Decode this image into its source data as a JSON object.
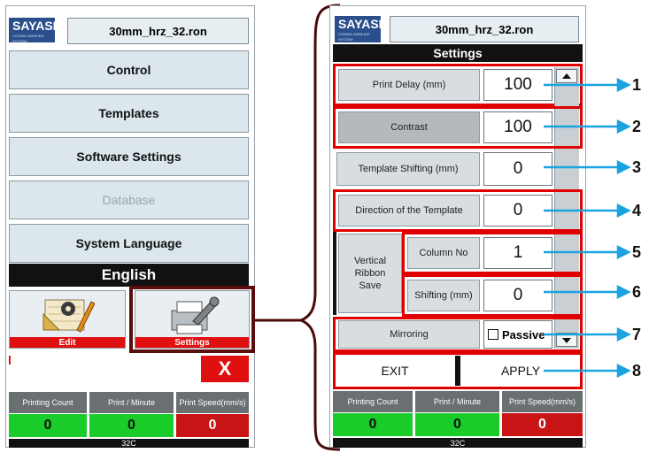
{
  "left": {
    "logo": "SAYASIS",
    "logo_sub": "CODING MARKING SYSTEM",
    "filename": "30mm_hrz_32.ron",
    "menu": [
      "Control",
      "Templates",
      "Software Settings",
      "Database",
      "System Language"
    ],
    "language": "English",
    "edit_label": "Edit",
    "settings_label": "Settings",
    "close_label": "X",
    "stats": {
      "printing_count_label": "Printing Count",
      "print_minute_label": "Print / Minute",
      "print_speed_label": "Print Speed(mm/s)",
      "printing_count": "0",
      "print_minute": "0",
      "print_speed": "0"
    },
    "footer": "32C"
  },
  "right": {
    "logo": "SAYASIS",
    "logo_sub": "CODING MARKING SYSTEM",
    "filename": "30mm_hrz_32.ron",
    "header": "Settings",
    "rows": {
      "print_delay": {
        "label": "Print Delay (mm)",
        "value": "100"
      },
      "contrast": {
        "label": "Contrast",
        "value": "100"
      },
      "template_shifting": {
        "label": "Template Shifting (mm)",
        "value": "0"
      },
      "direction": {
        "label": "Direction of the Template",
        "value": "0"
      },
      "vertical_ribbon": {
        "label": "Vertical Ribbon Save"
      },
      "column_no": {
        "label": "Column No",
        "value": "1"
      },
      "shifting": {
        "label": "Shifting (mm)",
        "value": "0"
      },
      "mirroring": {
        "label": "Mirroring",
        "checkbox_label": "Passive"
      }
    },
    "exit_label": "EXIT",
    "apply_label": "APPLY",
    "stats": {
      "printing_count_label": "Printing Count",
      "print_minute_label": "Print / Minute",
      "print_speed_label": "Print Speed(mm/s)",
      "printing_count": "0",
      "print_minute": "0",
      "print_speed": "0"
    },
    "footer": "32C"
  },
  "callouts": [
    "1",
    "2",
    "3",
    "4",
    "5",
    "6",
    "7",
    "8"
  ],
  "colors": {
    "arrow": "#1aa3e0",
    "highlight": "#e00000",
    "green": "#19cc2a",
    "red": "#c81414"
  }
}
